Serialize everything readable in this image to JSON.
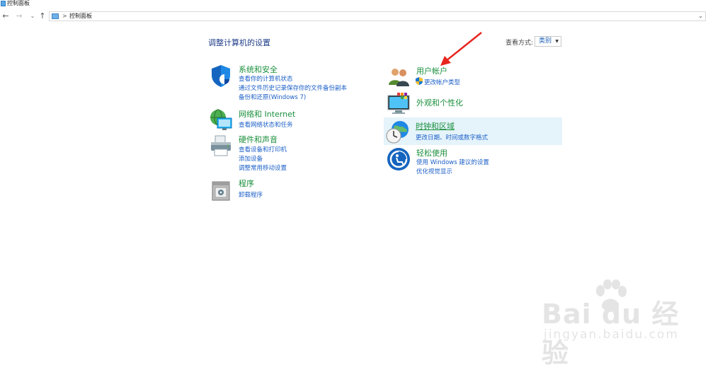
{
  "window": {
    "title": "控制面板"
  },
  "nav": {
    "back_glyph": "←",
    "forward_glyph": "→",
    "recent_glyph": "⌄",
    "up_glyph": "↑",
    "address_separator": ">",
    "address_text": "控制面板",
    "address_dropdown": "⌄"
  },
  "main": {
    "title": "调整计算机的设置",
    "view_by_label": "查看方式:",
    "view_by_value": "类别",
    "view_by_caret": "▼"
  },
  "categories": {
    "system": {
      "heading": "系统和安全",
      "links": [
        "查看你的计算机状态",
        "通过文件历史记录保存你的文件备份副本",
        "备份和还原(Windows 7)"
      ]
    },
    "network": {
      "heading": "网络和 Internet",
      "links": [
        "查看网络状态和任务"
      ]
    },
    "hardware": {
      "heading": "硬件和声音",
      "links": [
        "查看设备和打印机",
        "添加设备",
        "调整常用移动设置"
      ]
    },
    "programs": {
      "heading": "程序",
      "links": [
        "卸载程序"
      ]
    },
    "user_accounts": {
      "heading": "用户帐户",
      "links": [
        "更改帐户类型"
      ]
    },
    "appearance": {
      "heading": "外观和个性化",
      "links": []
    },
    "clock": {
      "heading": "时钟和区域",
      "links": [
        "更改日期、时间或数字格式"
      ]
    },
    "ease": {
      "heading": "轻松使用",
      "links": [
        "使用 Windows 建议的设置",
        "优化视觉显示"
      ]
    }
  },
  "watermark": {
    "brand": "Bai du 经验",
    "url": "jingyan.baidu.com"
  },
  "colors": {
    "accent_link": "#1b5fc7",
    "heading_green": "#1a8f3c",
    "title_blue": "#1f3c88",
    "arrow_red": "#e8261f"
  }
}
